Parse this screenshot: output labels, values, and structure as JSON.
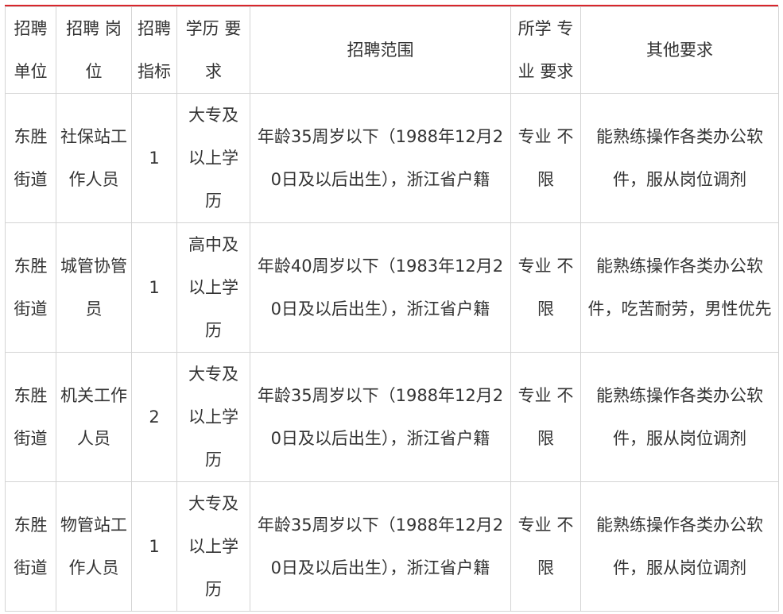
{
  "table": {
    "headers": [
      "招聘单位",
      "招聘 岗位",
      "招聘指标",
      "学历 要求",
      "招聘范围",
      "所学 专业 要求",
      "其他要求"
    ],
    "rows": [
      {
        "unit": "东胜街道",
        "position": "社保站工作人员",
        "quota": "1",
        "education": "大专及以上学历",
        "scope": "年龄35周岁以下（1988年12月20日及以后出生），浙江省户籍",
        "major": "专业 不限",
        "other": "能熟练操作各类办公软件，服从岗位调剂"
      },
      {
        "unit": "东胜街道",
        "position": "城管协管员",
        "quota": "1",
        "education": "高中及以上学历",
        "scope": "年龄40周岁以下（1983年12月20日及以后出生），浙江省户籍",
        "major": "专业 不限",
        "other": "能熟练操作各类办公软件，吃苦耐劳，男性优先"
      },
      {
        "unit": "东胜街道",
        "position": "机关工作人员",
        "quota": "2",
        "education": "大专及以上学历",
        "scope": "年龄35周岁以下（1988年12月20日及以后出生），浙江省户籍",
        "major": "专业 不限",
        "other": "能熟练操作各类办公软件，服从岗位调剂"
      },
      {
        "unit": "东胜街道",
        "position": "物管站工作人员",
        "quota": "1",
        "education": "大专及以上学历",
        "scope": "年龄35周岁以下（1988年12月20日及以后出生），浙江省户籍",
        "major": "专业 不限",
        "other": "能熟练操作各类办公软件，服从岗位调剂"
      }
    ]
  },
  "colors": {
    "top_rule": "#d9262c",
    "border": "#d4d4d4",
    "text": "#333333"
  }
}
